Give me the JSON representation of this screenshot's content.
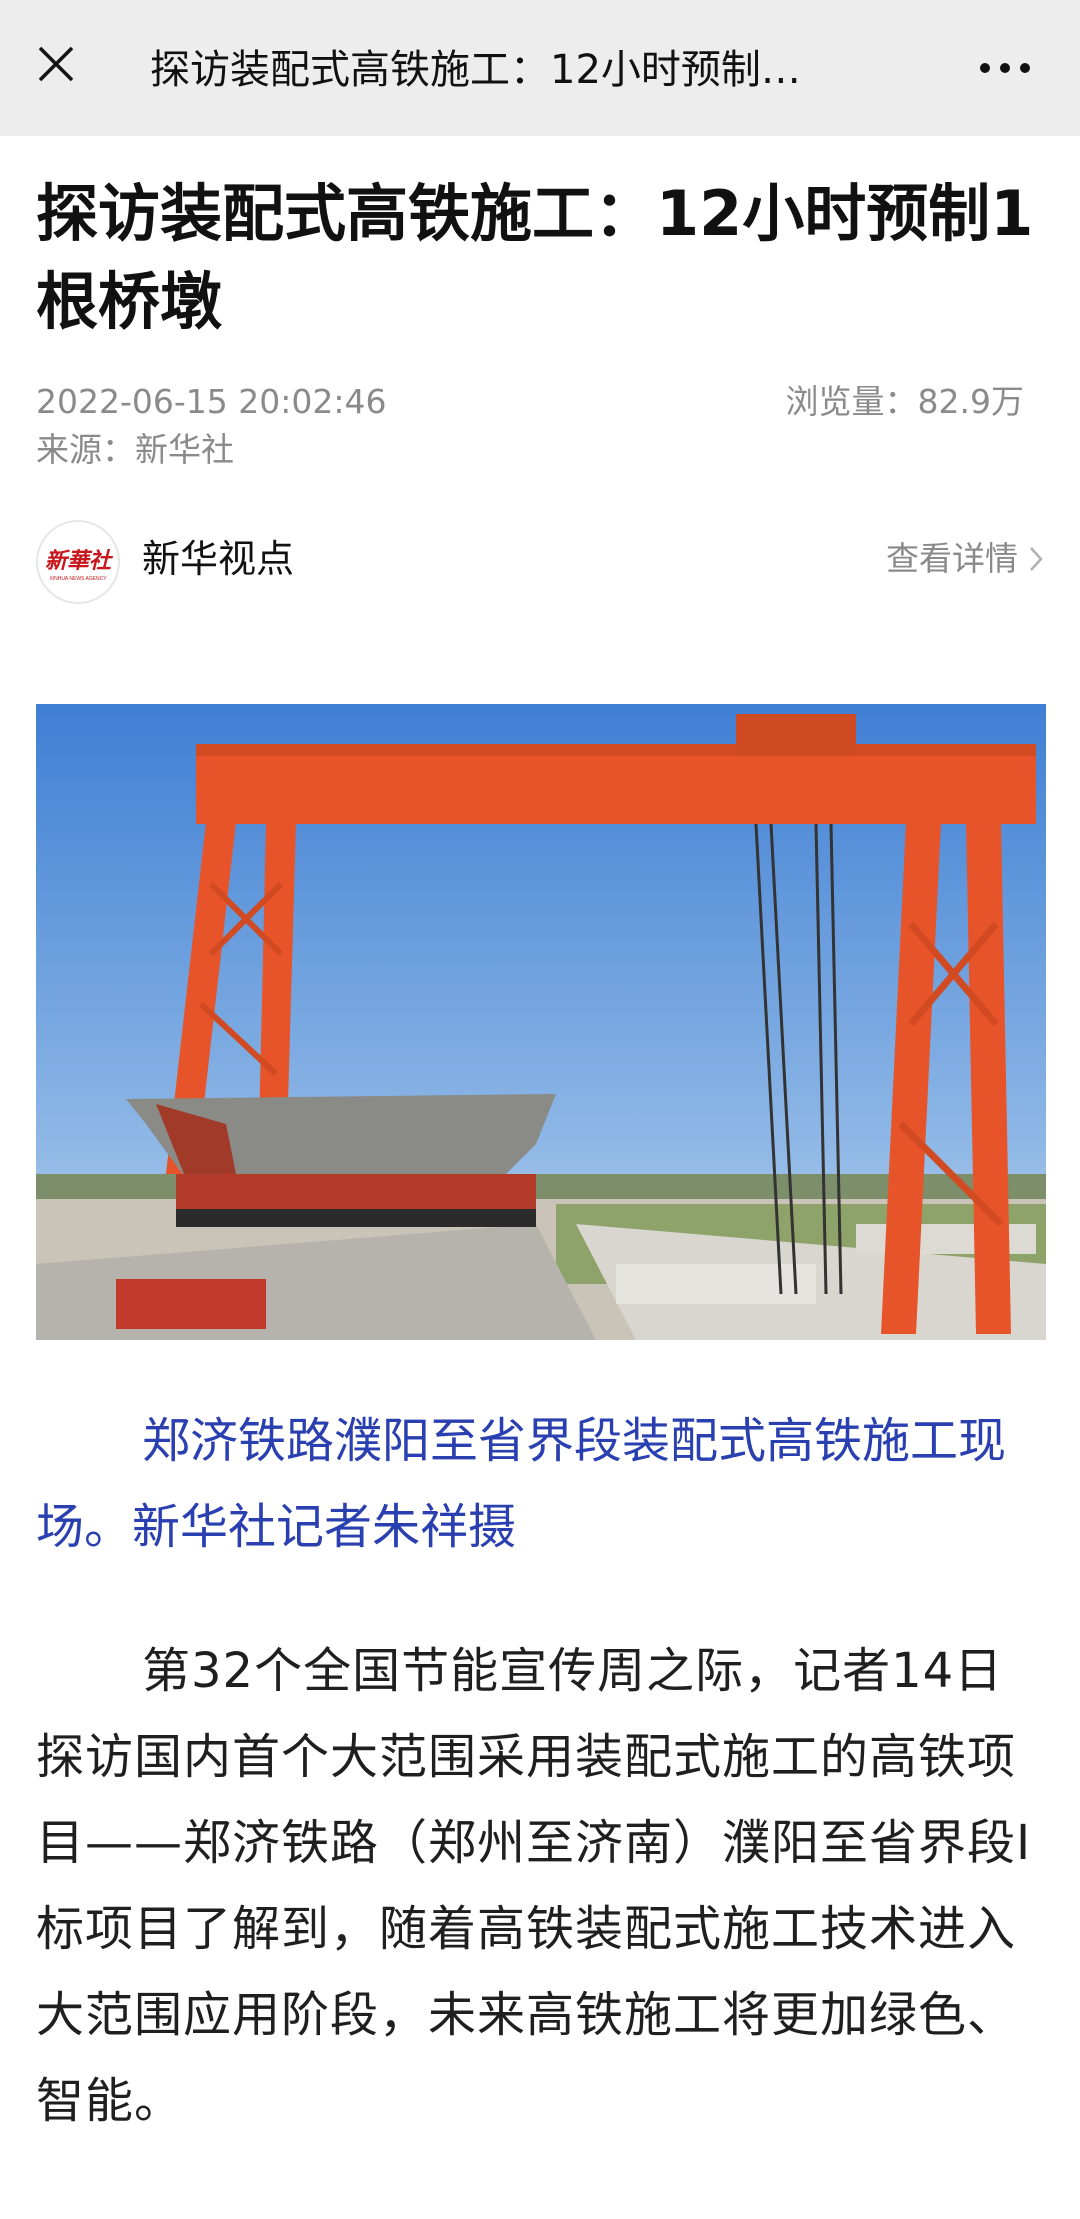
{
  "header": {
    "title": "探访装配式高铁施工：12小时预制…",
    "close_icon": "close-icon",
    "more_icon": "more-dots-icon"
  },
  "article": {
    "title": "探访装配式高铁施工：12小时预制1根桥墩",
    "date": "2022-06-15 20:02:46",
    "views": "浏览量：82.9万",
    "source": "来源：新华社"
  },
  "account": {
    "name": "新华视点",
    "view_details": "查看详情",
    "logo_text": "新华社"
  },
  "image": {
    "alt": "gantry-crane-construction-photo"
  },
  "caption": "郑济铁路濮阳至省界段装配式高铁施工现场。新华社记者朱祥摄",
  "paragraphs": [
    "第32个全国节能宣传周之际，记者14日探访国内首个大范围采用装配式施工的高铁项目——郑济铁路（郑州至济南）濮阳至省界段I标项目了解到，随着高铁装配式施工技术进入大范围应用阶段，未来高铁施工将更加绿色、智能。"
  ],
  "colors": {
    "topbar_bg": "#ededed",
    "caption": "#2a3fb0",
    "meta": "#8a8a8a",
    "crane": "#e8542a"
  }
}
